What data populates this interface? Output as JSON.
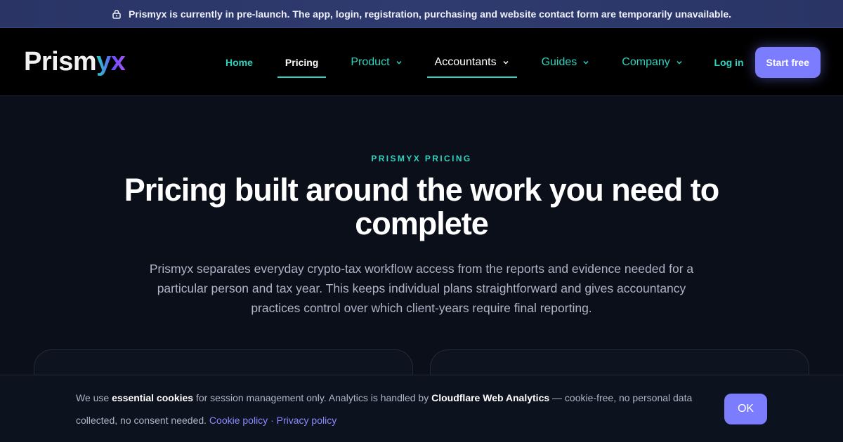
{
  "banner": {
    "icon": "lock-icon",
    "text": "Prismyx is currently in pre-launch. The app, login, registration, purchasing and website contact form are temporarily unavailable."
  },
  "nav": {
    "logo_main": "Prism",
    "logo_accent": "yx",
    "items": [
      {
        "label": "Home"
      },
      {
        "label": "Pricing"
      },
      {
        "label": "Product"
      },
      {
        "label": "Accountants"
      },
      {
        "label": "Guides"
      },
      {
        "label": "Company"
      }
    ],
    "login_label": "Log in",
    "start_label": "Start free"
  },
  "hero": {
    "eyebrow": "PRISMYX PRICING",
    "headline": "Pricing built around the work you need to complete",
    "lead": "Prismyx separates everyday crypto-tax workflow access from the reports and evidence needed for a particular person and tax year. This keeps individual plans straightforward and gives accountancy practices control over which client-years require final reporting."
  },
  "cookie": {
    "t1": "We use ",
    "b1": "essential cookies",
    "t2": " for session management only. Analytics is handled by ",
    "b2": "Cloudflare Web Analytics",
    "t3": " — cookie-free, no personal data collected, no consent needed. ",
    "link1": "Cookie policy",
    "sep": " · ",
    "link2": "Privacy policy",
    "ok_label": "OK"
  },
  "colors": {
    "accent_teal": "#2dd4bf",
    "accent_violet": "#7c7cff",
    "background": "#0b0f1a"
  }
}
